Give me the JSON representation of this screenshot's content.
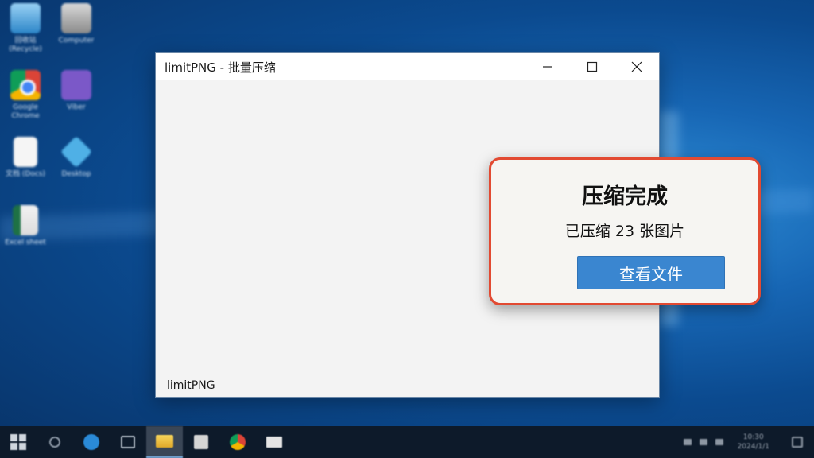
{
  "desktop": {
    "icons": [
      {
        "label": "回收站\n(Recycle)",
        "icon": "recycle-bin-icon"
      },
      {
        "label": "Computer",
        "icon": "computer-icon"
      },
      {
        "label": "Google\nChrome",
        "icon": "chrome-icon"
      },
      {
        "label": "Viber",
        "icon": "viber-icon"
      },
      {
        "label": "文档\n(Docs)",
        "icon": "document-icon"
      },
      {
        "label": "Desktop",
        "icon": "cube-icon"
      },
      {
        "label": "Excel\nsheet",
        "icon": "spreadsheet-icon"
      }
    ]
  },
  "window": {
    "title": "limitPNG - 批量压缩",
    "footer": "limitPNG",
    "controls": {
      "minimize": "minimize-icon",
      "maximize": "maximize-icon",
      "close": "close-icon"
    }
  },
  "toast": {
    "title": "压缩完成",
    "message": "已压缩 23 张图片",
    "button": "查看文件",
    "border_color": "#e24a32",
    "button_color": "#3a86d0"
  },
  "taskbar": {
    "items": [
      "start-icon",
      "search-icon",
      "edge-icon",
      "task-view-icon",
      "file-explorer-icon",
      "store-icon",
      "chrome-icon",
      "mail-icon"
    ],
    "active_item": "file-explorer-icon",
    "clock": {
      "time": "10:30",
      "date": "2024/1/1"
    }
  }
}
